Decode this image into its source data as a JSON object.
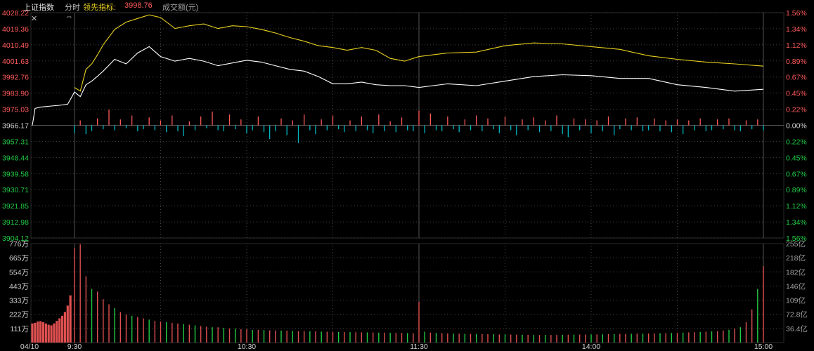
{
  "header": {
    "index_name": "上证指数",
    "mode": "分时",
    "leader_label": "领先指标:",
    "leader_value": "3998.76",
    "volume_label": "成交额(元)"
  },
  "colors": {
    "price_line": "#ffffff",
    "leader_line": "#e8d020",
    "up": "#ff5a5a",
    "down": "#00b7c3",
    "green": "#22cc44",
    "grid_solid": "#2a2a2a",
    "grid_dotted": "#444444",
    "vol_up": "#e05050",
    "vol_down": "#22cc44"
  },
  "icons": {
    "close": "close-icon",
    "resize": "resize-icon"
  },
  "chart_data": [
    {
      "type": "line",
      "title": "",
      "prev_close": 3966.17,
      "ylim": [
        3904.12,
        4028.22
      ],
      "y_ticks_left": [
        "4028.22",
        "4019.36",
        "4010.49",
        "4001.63",
        "3992.76",
        "3983.90",
        "3975.03",
        "3966.17",
        "3957.31",
        "3948.44",
        "3939.58",
        "3930.71",
        "3921.85",
        "3912.98",
        "3904.12"
      ],
      "y_ticks_right": [
        "1.56%",
        "1.34%",
        "1.12%",
        "0.89%",
        "0.67%",
        "0.45%",
        "0.22%",
        "0.00%",
        "0.22%",
        "0.45%",
        "0.67%",
        "0.89%",
        "1.12%",
        "1.34%",
        "1.56%"
      ],
      "x_ticks": [
        "04/10",
        "9:30",
        "10:30",
        "11:30",
        "14:00",
        "15:00"
      ],
      "series": [
        {
          "role": "price",
          "x": [
            -15,
            -14,
            -12,
            -10,
            -8,
            -5,
            -2,
            0,
            2,
            4,
            6,
            8,
            10,
            14,
            18,
            22,
            26,
            30,
            35,
            40,
            45,
            50,
            55,
            60,
            65,
            70,
            75,
            80,
            85,
            90,
            95,
            100,
            105,
            110,
            115,
            120,
            130,
            140,
            150,
            160,
            170,
            180,
            190,
            200,
            210,
            220,
            230,
            240
          ],
          "y": [
            3966.17,
            3975.5,
            3976.2,
            3976.5,
            3976.8,
            3977.2,
            3977.8,
            3984.5,
            3982.0,
            3988.5,
            3990.5,
            3993.2,
            3996.0,
            4002.5,
            4000.0,
            4006.0,
            4009.5,
            4004.0,
            4001.5,
            4003.0,
            4001.5,
            3999.0,
            4000.5,
            4002.0,
            4001.0,
            3999.0,
            3997.0,
            3996.0,
            3993.0,
            3989.0,
            3989.0,
            3990.0,
            3988.5,
            3988.0,
            3988.0,
            3987.0,
            3989.0,
            3988.0,
            3990.5,
            3993.0,
            3994.0,
            3993.5,
            3992.0,
            3992.0,
            3988.5,
            3987.0,
            3985.0,
            3986.0
          ]
        },
        {
          "role": "leader",
          "x": [
            0,
            2,
            4,
            6,
            8,
            10,
            14,
            18,
            22,
            26,
            30,
            35,
            40,
            45,
            50,
            55,
            60,
            65,
            70,
            75,
            80,
            85,
            90,
            95,
            100,
            105,
            110,
            115,
            120,
            130,
            140,
            150,
            160,
            170,
            180,
            190,
            200,
            210,
            220,
            230,
            240
          ],
          "y": [
            3987.0,
            3985.0,
            3997.0,
            4000.0,
            4005.0,
            4010.5,
            4019.0,
            4023.0,
            4025.0,
            4027.0,
            4025.5,
            4019.5,
            4021.0,
            4022.0,
            4019.5,
            4021.0,
            4020.5,
            4019.0,
            4017.0,
            4014.5,
            4012.5,
            4010.0,
            4009.0,
            4007.5,
            4009.0,
            4007.5,
            4003.0,
            4001.5,
            4004.0,
            4006.0,
            4006.5,
            4010.0,
            4011.5,
            4011.0,
            4009.5,
            4008.0,
            4004.5,
            4002.5,
            4001.0,
            4000.0,
            3998.76
          ]
        }
      ],
      "minute_bars": {
        "x_start": 0,
        "x_end": 240,
        "step": 2,
        "values": [
          -0.8,
          0.5,
          -0.9,
          -0.6,
          0.7,
          -0.4,
          1.6,
          -0.5,
          0.6,
          -0.3,
          1.0,
          -0.6,
          -0.4,
          0.8,
          -0.5,
          0.5,
          -0.7,
          1.0,
          -0.6,
          -1.1,
          0.4,
          -0.5,
          0.9,
          -0.3,
          1.4,
          -0.5,
          -0.6,
          1.1,
          -0.4,
          0.6,
          -0.8,
          -0.5,
          0.9,
          -0.7,
          -1.4,
          -0.6,
          0.7,
          -1.0,
          0.5,
          -1.8,
          1.1,
          -0.5,
          -0.9,
          0.6,
          -0.5,
          1.0,
          -0.4,
          -0.7,
          0.5,
          -0.6,
          0.9,
          -0.5,
          -0.8,
          1.1,
          -0.6,
          0.4,
          -0.7,
          0.8,
          -0.5,
          -0.6,
          1.5,
          -0.8,
          1.2,
          -0.5,
          -0.6,
          0.9,
          -0.4,
          -0.7,
          0.6,
          -0.5,
          1.0,
          -0.6,
          0.7,
          -0.4,
          -0.8,
          0.9,
          -0.5,
          -1.0,
          0.6,
          -0.5,
          0.8,
          -0.7,
          0.5,
          -0.6,
          1.0,
          -0.9,
          -1.2,
          0.7,
          -0.5,
          0.6,
          -0.8,
          0.5,
          -0.6,
          0.9,
          -1.0,
          -0.4,
          0.7,
          -0.5,
          0.8,
          -0.6,
          -0.5,
          0.7,
          -0.6,
          0.5,
          -0.7,
          0.6,
          -0.9,
          0.5,
          -0.5,
          0.7,
          -0.6,
          -0.5,
          0.6,
          -0.4,
          0.7,
          -0.5,
          -0.6,
          0.5,
          -0.4,
          0.6,
          -0.5
        ]
      }
    },
    {
      "type": "bar",
      "title": "",
      "ylim": [
        0,
        776
      ],
      "y_ticks_left": [
        "776万",
        "665万",
        "554万",
        "443万",
        "333万",
        "222万",
        "111万"
      ],
      "y_ticks_right": [
        "255亿",
        "218亿",
        "182亿",
        "146亿",
        "109亿",
        "72.8亿",
        "36.4亿"
      ],
      "pre_open_x": [
        -15,
        -14,
        -13,
        -12,
        -11,
        -10,
        -9,
        -8,
        -7,
        -6,
        -5,
        -4,
        -3,
        -2,
        -1
      ],
      "pre_open_values": [
        150,
        155,
        165,
        168,
        160,
        150,
        140,
        135,
        150,
        170,
        190,
        210,
        240,
        290,
        370
      ],
      "x_start": 0,
      "x_end": 240,
      "step": 2,
      "values": [
        740,
        770,
        520,
        420,
        400,
        340,
        300,
        270,
        240,
        220,
        210,
        200,
        190,
        180,
        170,
        165,
        160,
        155,
        150,
        145,
        140,
        135,
        130,
        125,
        120,
        120,
        115,
        110,
        110,
        105,
        105,
        100,
        100,
        98,
        96,
        95,
        94,
        93,
        92,
        90,
        90,
        88,
        88,
        86,
        85,
        84,
        83,
        82,
        82,
        81,
        80,
        80,
        79,
        78,
        78,
        77,
        76,
        76,
        75,
        74,
        320,
        85,
        78,
        76,
        74,
        72,
        70,
        70,
        69,
        68,
        67,
        66,
        66,
        65,
        64,
        64,
        63,
        62,
        62,
        61,
        60,
        60,
        60,
        60,
        60,
        61,
        62,
        62,
        63,
        63,
        64,
        64,
        65,
        66,
        67,
        68,
        68,
        69,
        70,
        70,
        71,
        72,
        73,
        74,
        75,
        76,
        78,
        80,
        82,
        84,
        86,
        88,
        90,
        95,
        100,
        110,
        120,
        160,
        260,
        420,
        600
      ],
      "colors": [
        "up",
        "up",
        "up",
        "down",
        "up",
        "up",
        "up",
        "down",
        "up",
        "up",
        "down",
        "up",
        "up",
        "down",
        "up",
        "up",
        "down",
        "up",
        "up",
        "down",
        "up",
        "down",
        "up",
        "up",
        "down",
        "up",
        "down",
        "up",
        "down",
        "up",
        "up",
        "down",
        "up",
        "down",
        "up",
        "up",
        "down",
        "up",
        "down",
        "up",
        "up",
        "down",
        "up",
        "down",
        "up",
        "up",
        "down",
        "up",
        "down",
        "up",
        "up",
        "down",
        "up",
        "down",
        "up",
        "down",
        "up",
        "up",
        "down",
        "up",
        "up",
        "down",
        "up",
        "down",
        "up",
        "up",
        "down",
        "up",
        "down",
        "up",
        "down",
        "up",
        "up",
        "down",
        "up",
        "down",
        "up",
        "up",
        "down",
        "up",
        "down",
        "up",
        "down",
        "up",
        "up",
        "down",
        "up",
        "down",
        "up",
        "up",
        "down",
        "up",
        "down",
        "up",
        "down",
        "up",
        "up",
        "down",
        "up",
        "down",
        "up",
        "up",
        "down",
        "up",
        "down",
        "up",
        "down",
        "up",
        "up",
        "down",
        "up",
        "down",
        "up",
        "up",
        "down",
        "up",
        "down",
        "up",
        "up",
        "down",
        "up"
      ]
    }
  ]
}
